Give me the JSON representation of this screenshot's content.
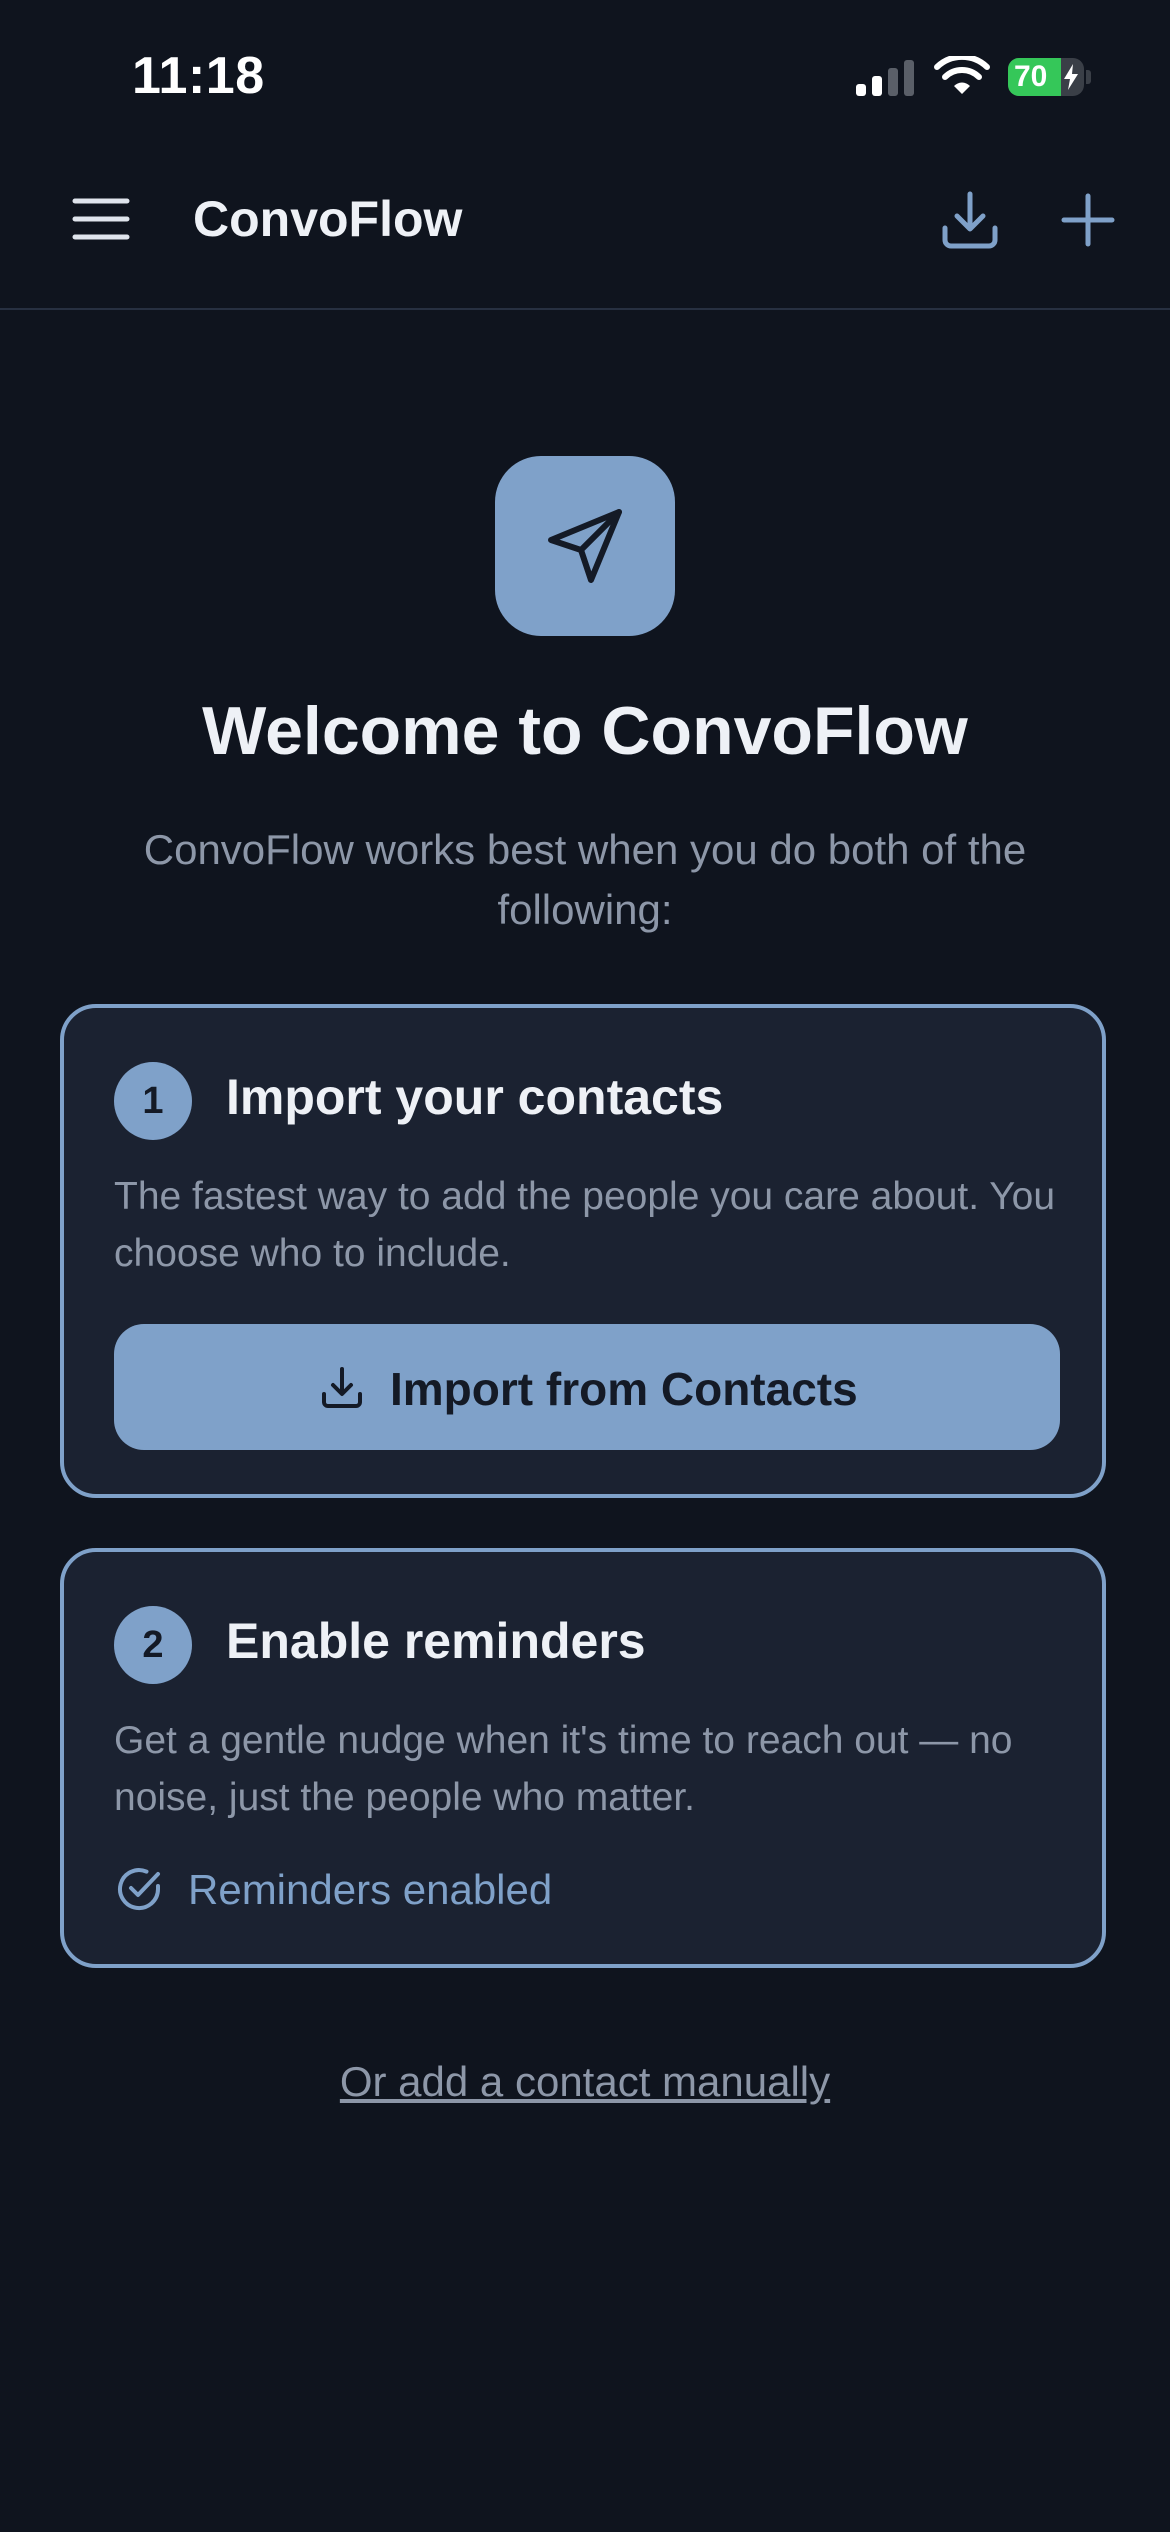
{
  "status_bar": {
    "time": "11:18",
    "battery_percent": 70,
    "battery_label": "70",
    "charging": true,
    "icons": [
      "cellular-signal-icon",
      "wifi-icon",
      "battery-icon",
      "charging-bolt-icon"
    ]
  },
  "header": {
    "title": "ConvoFlow",
    "icons": [
      "menu-icon",
      "download-icon",
      "plus-icon"
    ]
  },
  "hero": {
    "icon": "paper-plane-icon",
    "title": "Welcome to ConvoFlow",
    "subtitle": "ConvoFlow works best when you do both of the following:"
  },
  "steps": [
    {
      "number": "1",
      "title": "Import your contacts",
      "description": "The fastest way to add the people you care about. You choose who to include.",
      "button_label": "Import from Contacts",
      "button_icon": "download-icon"
    },
    {
      "number": "2",
      "title": "Enable reminders",
      "description": "Get a gentle nudge when it's time to reach out — no noise, just the people who matter.",
      "status_label": "Reminders enabled",
      "status_icon": "check-circle-icon"
    }
  ],
  "footer": {
    "manual_link": "Or add a contact manually"
  },
  "colors": {
    "background": "#0f141e",
    "card_background": "#1b2231",
    "accent": "#7fa1c9",
    "text_primary": "#eef1f6",
    "text_secondary": "#8d97a8",
    "battery_green": "#35c759"
  }
}
